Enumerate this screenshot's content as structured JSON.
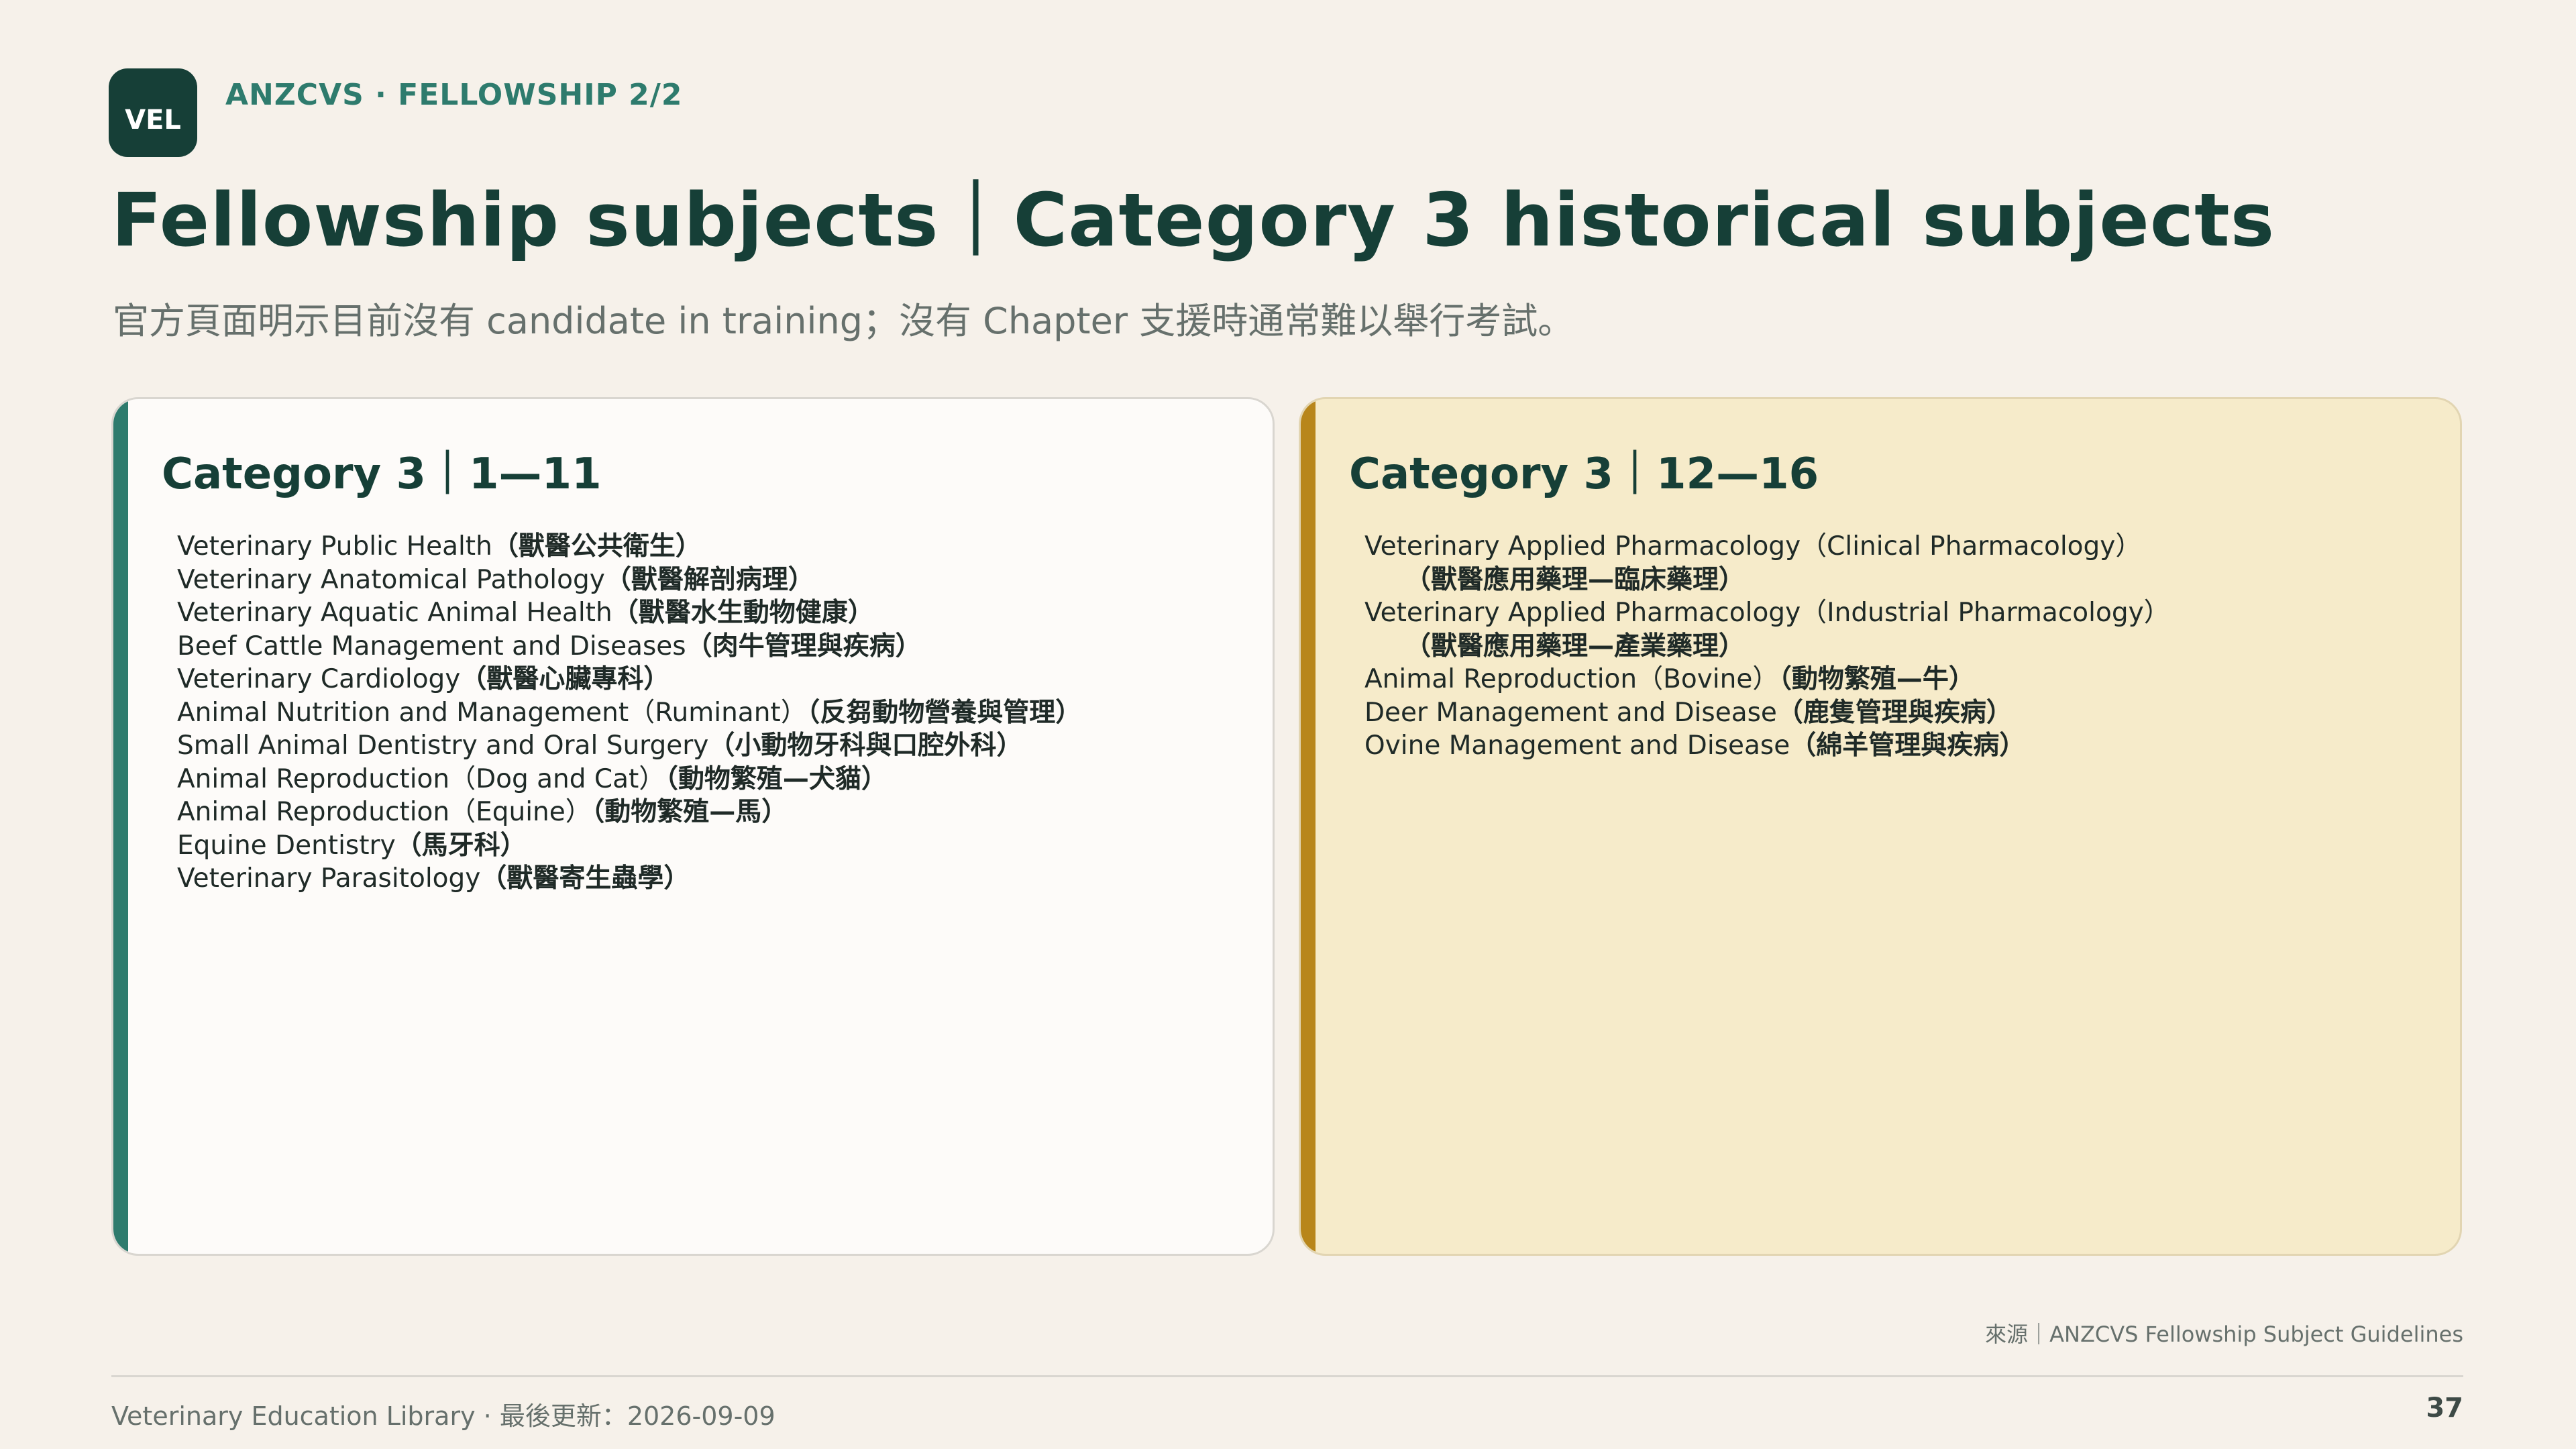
{
  "header": {
    "logo": "VEL",
    "kicker": "ANZCVS · FELLOWSHIP 2/2",
    "title": "Fellowship subjects｜Category 3 historical subjects",
    "subtitle": "官方頁面明示目前沒有 candidate in training；沒有 Chapter 支援時通常難以舉行考試。"
  },
  "left_card": {
    "title": "Category 3｜1—11",
    "items": [
      {
        "en": "Veterinary Public Health",
        "zh": "（獸醫公共衛生）"
      },
      {
        "en": "Veterinary Anatomical Pathology",
        "zh": "（獸醫解剖病理）"
      },
      {
        "en": "Veterinary Aquatic Animal Health",
        "zh": "（獸醫水生動物健康）"
      },
      {
        "en": "Beef Cattle Management and Diseases",
        "zh": "（肉牛管理與疾病）"
      },
      {
        "en": "Veterinary Cardiology",
        "zh": "（獸醫心臟專科）"
      },
      {
        "en": "Animal Nutrition and Management（Ruminant）",
        "zh": "（反芻動物營養與管理）"
      },
      {
        "en": "Small Animal Dentistry and Oral Surgery",
        "zh": "（小動物牙科與口腔外科）"
      },
      {
        "en": "Animal Reproduction（Dog and Cat）",
        "zh": "（動物繁殖—犬貓）"
      },
      {
        "en": "Animal Reproduction（Equine）",
        "zh": "（動物繁殖—馬）"
      },
      {
        "en": "Equine Dentistry",
        "zh": "（馬牙科）"
      },
      {
        "en": "Veterinary Parasitology",
        "zh": "（獸醫寄生蟲學）"
      }
    ]
  },
  "right_card": {
    "title": "Category 3｜12—16",
    "items": [
      {
        "en": "Veterinary Applied Pharmacology（Clinical Pharmacology）",
        "zh": "（獸醫應用藥理—臨床藥理）"
      },
      {
        "en": "Veterinary Applied Pharmacology（Industrial Pharmacology）",
        "zh": "（獸醫應用藥理—產業藥理）"
      },
      {
        "en": "Animal Reproduction（Bovine）",
        "zh": "（動物繁殖—牛）"
      },
      {
        "en": "Deer Management and Disease",
        "zh": "（鹿隻管理與疾病）"
      },
      {
        "en": "Ovine Management and Disease",
        "zh": "（綿羊管理與疾病）"
      }
    ]
  },
  "footer": {
    "source": "來源｜ANZCVS Fellowship Subject Guidelines",
    "left": "Veterinary Education Library · 最後更新：2026-09-09",
    "page": "37"
  },
  "colors": {
    "background": "#f6f1ea",
    "primary": "#163f37",
    "teal_accent": "#2e7b6d",
    "gold_accent": "#b8861b",
    "right_card_bg": "#f6ebca"
  }
}
